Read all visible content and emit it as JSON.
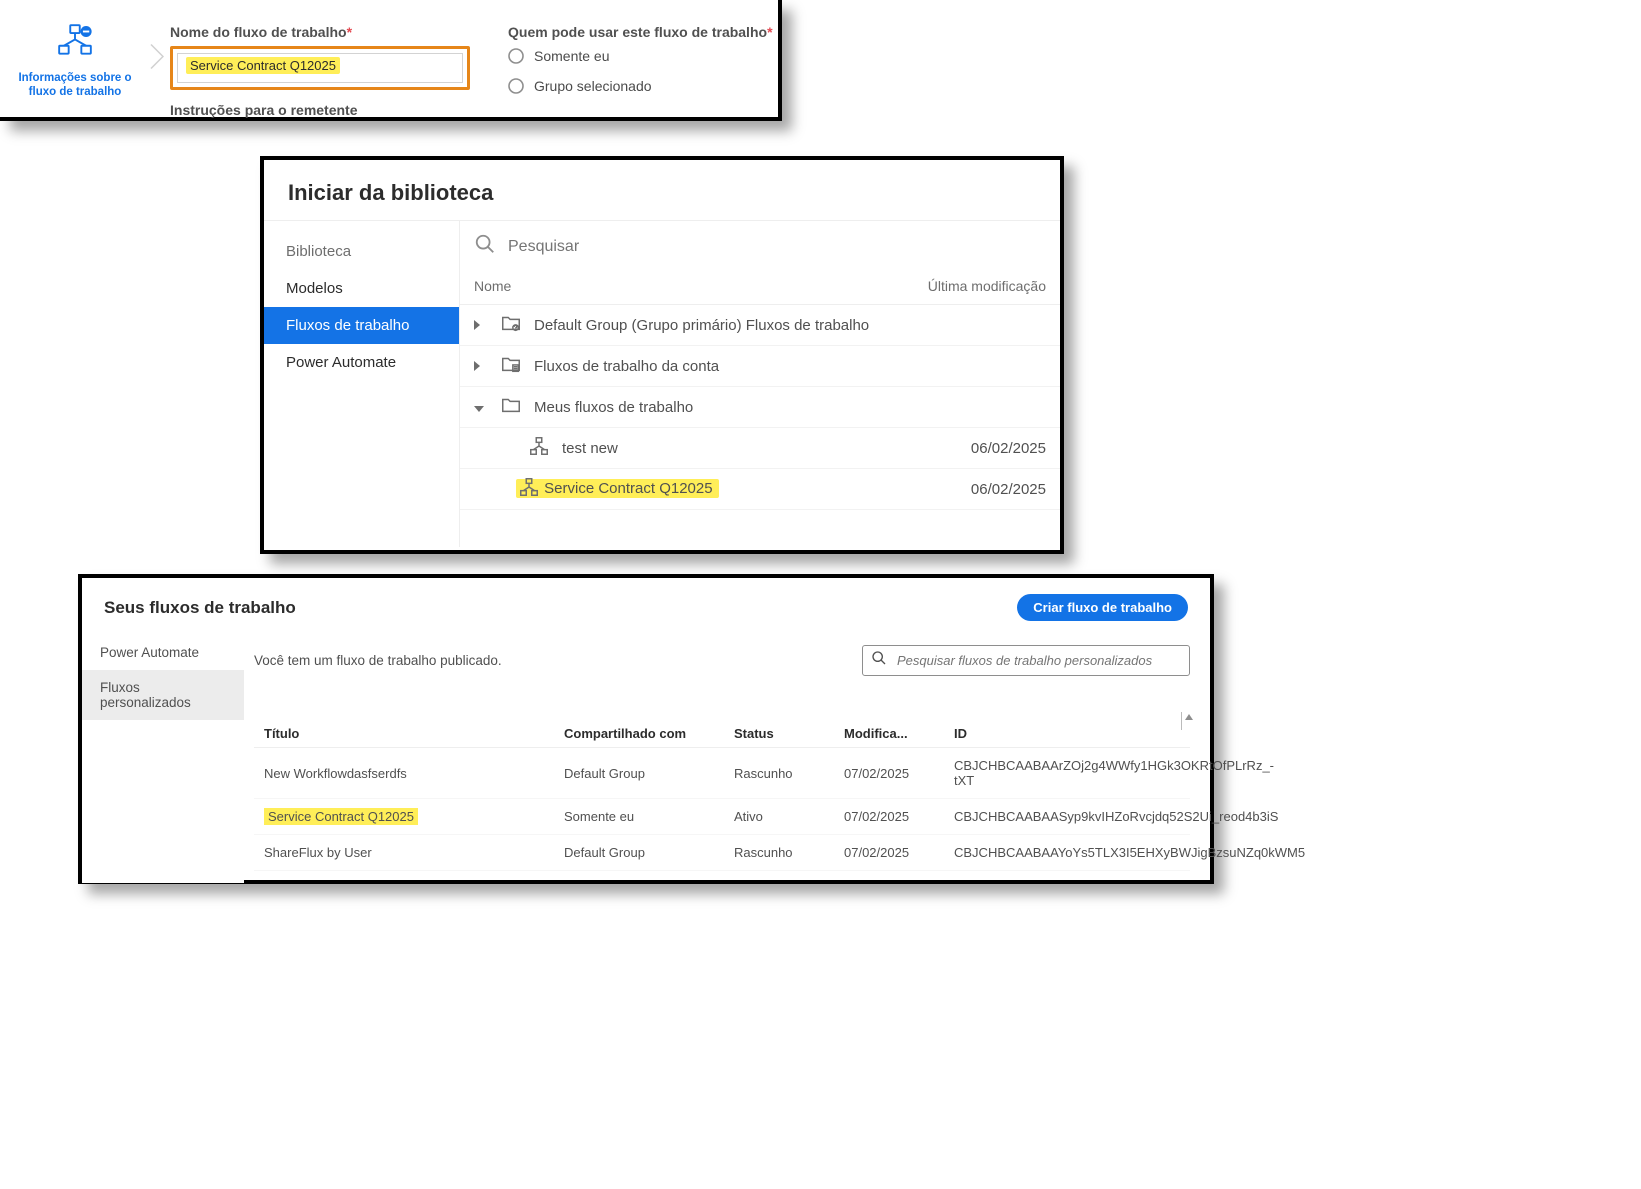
{
  "panel1": {
    "nav_label_line1": "Informações sobre o",
    "nav_label_line2": "fluxo de trabalho",
    "name_label": "Nome do fluxo de trabalho",
    "name_value": "Service Contract Q12025",
    "who_label": "Quem pode usar este fluxo de trabalho",
    "radio_me": "Somente eu",
    "radio_group": "Grupo selecionado",
    "instructions_label": "Instruções para o remetente"
  },
  "panel2": {
    "title": "Iniciar da biblioteca",
    "sidebar_header": "Biblioteca",
    "sidebar_items": [
      "Modelos",
      "Fluxos de trabalho",
      "Power Automate"
    ],
    "search_placeholder": "Pesquisar",
    "col_name": "Nome",
    "col_modified": "Última modificação",
    "rows": [
      {
        "type": "folder-org",
        "name": "Default Group (Grupo primário) Fluxos de trabalho",
        "date": "",
        "expand": "closed",
        "indent": 0
      },
      {
        "type": "folder-acct",
        "name": "Fluxos de trabalho da conta",
        "date": "",
        "expand": "closed",
        "indent": 0
      },
      {
        "type": "folder",
        "name": "Meus fluxos de trabalho",
        "date": "",
        "expand": "open",
        "indent": 0
      },
      {
        "type": "workflow",
        "name": "test new",
        "date": "06/02/2025",
        "expand": "",
        "indent": 1
      },
      {
        "type": "workflow",
        "name": "Service Contract Q12025",
        "date": "06/02/2025",
        "expand": "",
        "indent": 1,
        "highlight": true
      }
    ]
  },
  "panel3": {
    "title": "Seus fluxos de trabalho",
    "create_btn": "Criar fluxo de trabalho",
    "nav_items": [
      "Power Automate",
      "Fluxos personalizados"
    ],
    "info_text": "Você tem um fluxo de trabalho publicado.",
    "search_placeholder": "Pesquisar fluxos de trabalho personalizados",
    "columns": [
      "Título",
      "Compartilhado com",
      "Status",
      "Modifica...",
      "ID"
    ],
    "rows": [
      {
        "title": "New Workflowdasfserdfs",
        "shared": "Default Group",
        "status": "Rascunho",
        "modified": "07/02/2025",
        "id": "CBJCHBCAABAArZOj2g4WWfy1HGk3OKRtOfPLrRz_-tXT"
      },
      {
        "title": "Service Contract Q12025",
        "shared": "Somente eu",
        "status": "Ativo",
        "modified": "07/02/2025",
        "id": "CBJCHBCAABAASyp9kvIHZoRvcjdq52S2Ui_reod4b3iS",
        "highlight": true
      },
      {
        "title": "ShareFlux by User",
        "shared": "Default Group",
        "status": "Rascunho",
        "modified": "07/02/2025",
        "id": "CBJCHBCAABAAYoYs5TLX3I5EHXyBWJigBzsuNZq0kWM5"
      }
    ]
  }
}
